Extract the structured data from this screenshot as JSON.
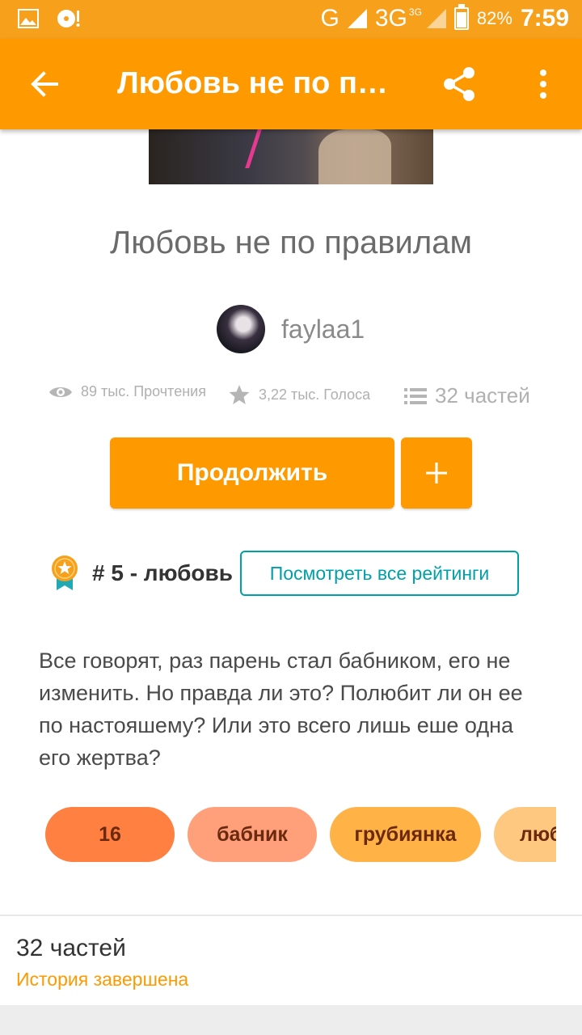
{
  "status_bar": {
    "network_g": "G",
    "network_3g": "3G",
    "network_3g_sup": "3G",
    "battery": "82%",
    "time": "7:59",
    "icons": [
      "gallery-icon",
      "media-icon",
      "signal-icon",
      "battery-icon"
    ]
  },
  "app_bar": {
    "title": "Любовь не по правилам",
    "back_icon": "arrow-left-icon",
    "share_icon": "share-icon",
    "more_icon": "more-vertical-icon"
  },
  "story": {
    "title": "Любовь не по правилам",
    "author": "faylaa1",
    "reads": "89 тыс. Прочтения",
    "votes": "3,22 тыс. Голоса",
    "parts": "32 частей",
    "continue_label": "Продолжить",
    "add_label": "+",
    "rank": "# 5 - любовь",
    "ratings_button": "Посмотреть все рейтинги",
    "description": "Все говорят, раз парень стал бабником, его не изменить. Но правда ли это? Полюбит ли он ее по настояшему? Или это всего лишь еше одна его жертва?",
    "tags": [
      "16",
      "бабник",
      "грубиянка",
      "любовь"
    ]
  },
  "footer": {
    "parts_count": "32 частей",
    "status": "История завершена"
  },
  "colors": {
    "accent": "#FF9900",
    "status_bar": "#F7A01C",
    "teal": "#00A0A8",
    "tag_1": "#FF8040",
    "tag_2": "#FFA07A",
    "tag_3": "#FFB347",
    "tag_4": "#FFC880"
  }
}
